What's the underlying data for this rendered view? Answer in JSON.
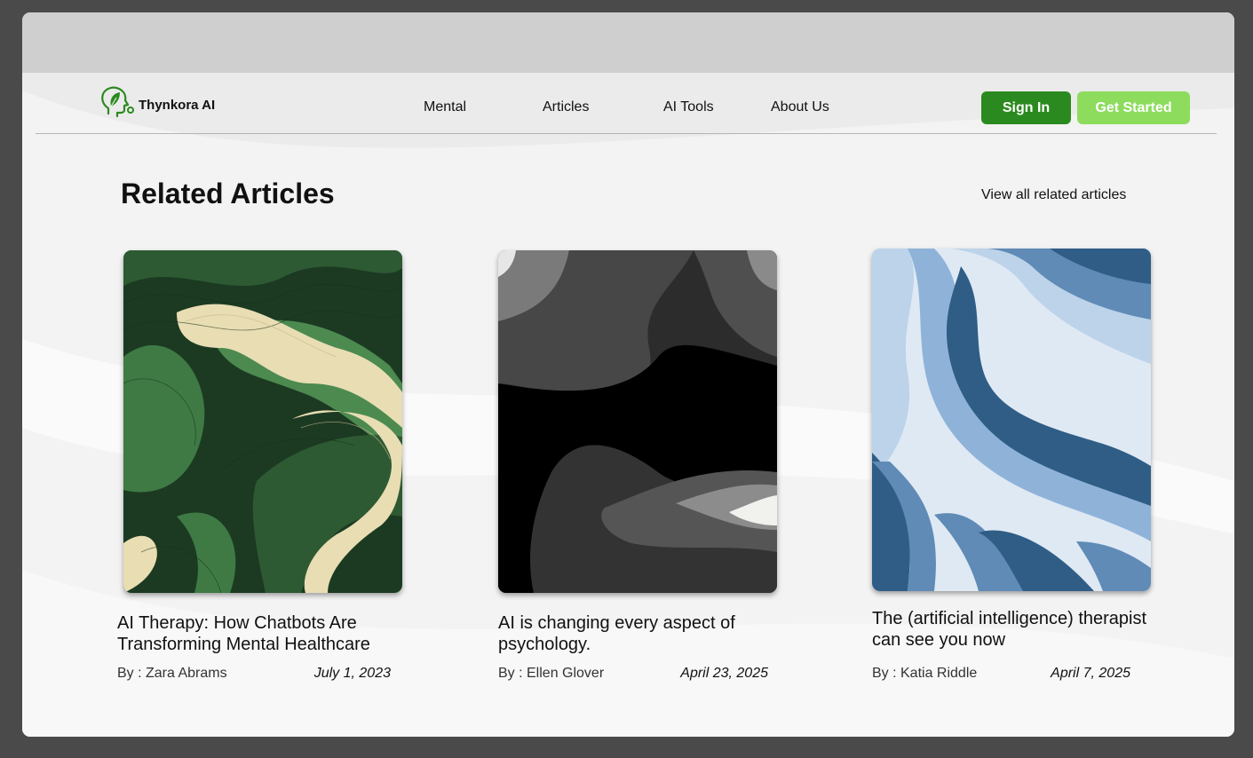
{
  "brand": {
    "name": "Thynkora AI",
    "logo_icon": "head-leaf-icon",
    "color": "#2b8a1f"
  },
  "nav": {
    "items": [
      {
        "label": "Mental"
      },
      {
        "label": "Articles"
      },
      {
        "label": "AI Tools"
      },
      {
        "label": "About Us"
      }
    ]
  },
  "actions": {
    "sign_in": "Sign In",
    "get_started": "Get Started"
  },
  "section": {
    "title": "Related Articles",
    "view_all": "View all related articles"
  },
  "articles": [
    {
      "title": "AI Therapy: How Chatbots Are Transforming Mental Healthcare",
      "author": "By : Zara Abrams",
      "date": "July 1, 2023",
      "image": "green-cream-wave-pattern"
    },
    {
      "title": "AI is changing every aspect of psychology.",
      "author": "By : Ellen Glover",
      "date": "April 23, 2025",
      "image": "black-grey-wave-pattern"
    },
    {
      "title": "The (artificial intelligence) therapist can see you now",
      "author": "By : Katia Riddle",
      "date": "April 7, 2025",
      "image": "blue-wave-pattern"
    }
  ],
  "colors": {
    "primary": "#2b8a1f",
    "secondary": "#8ddc5e",
    "background": "#f3f3f3",
    "frame": "#4a4a4a"
  }
}
